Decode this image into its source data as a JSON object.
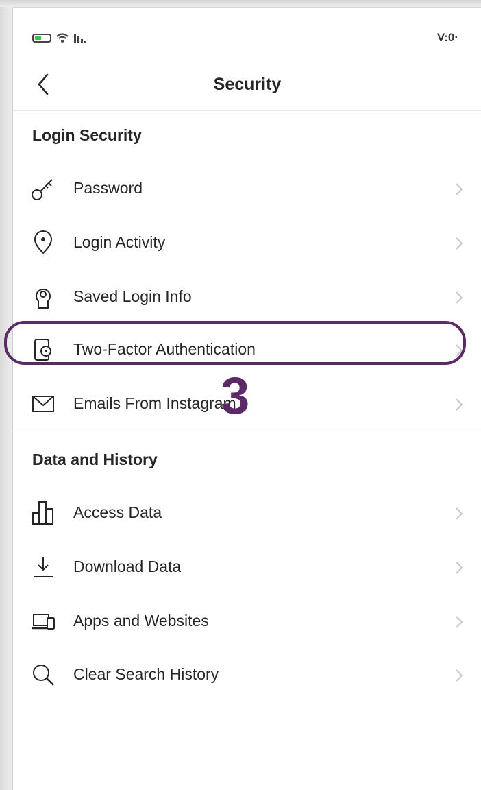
{
  "status_bar": {
    "time": "V:0·"
  },
  "nav": {
    "title": "Security"
  },
  "sections": [
    {
      "header": "Login Security",
      "items": [
        {
          "label": "Password",
          "icon": "key-icon"
        },
        {
          "label": "Login Activity",
          "icon": "location-pin-icon"
        },
        {
          "label": "Saved Login Info",
          "icon": "keyhole-icon"
        },
        {
          "label": "Two-Factor Authentication",
          "icon": "phone-shield-icon"
        },
        {
          "label": "Emails From Instagram",
          "icon": "envelope-icon"
        }
      ]
    },
    {
      "header": "Data and History",
      "items": [
        {
          "label": "Access Data",
          "icon": "bar-chart-icon"
        },
        {
          "label": "Download Data",
          "icon": "download-icon"
        },
        {
          "label": "Apps and Websites",
          "icon": "laptop-phone-icon"
        },
        {
          "label": "Clear Search History",
          "icon": "search-icon"
        }
      ]
    }
  ],
  "annotation": {
    "step_number": "3",
    "highlight_color": "#5b2a67"
  },
  "colors": {
    "text": "#262626",
    "chevron": "#c7c7c7",
    "background": "#ffffff"
  }
}
